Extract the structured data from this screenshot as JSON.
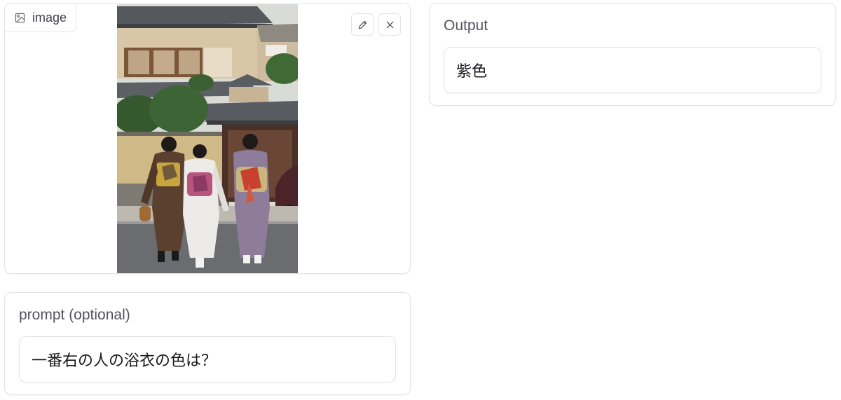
{
  "image_block": {
    "label": "image",
    "label_icon": "image-icon",
    "edit_icon": "pencil-icon",
    "clear_icon": "close-icon"
  },
  "prompt_block": {
    "label": "prompt (optional)",
    "value": "一番右の人の浴衣の色は？"
  },
  "output_block": {
    "label": "Output",
    "value": "紫色"
  },
  "colors": {
    "border": "#e4e4e7",
    "label_text": "#52525b",
    "body_text": "#18181b"
  }
}
